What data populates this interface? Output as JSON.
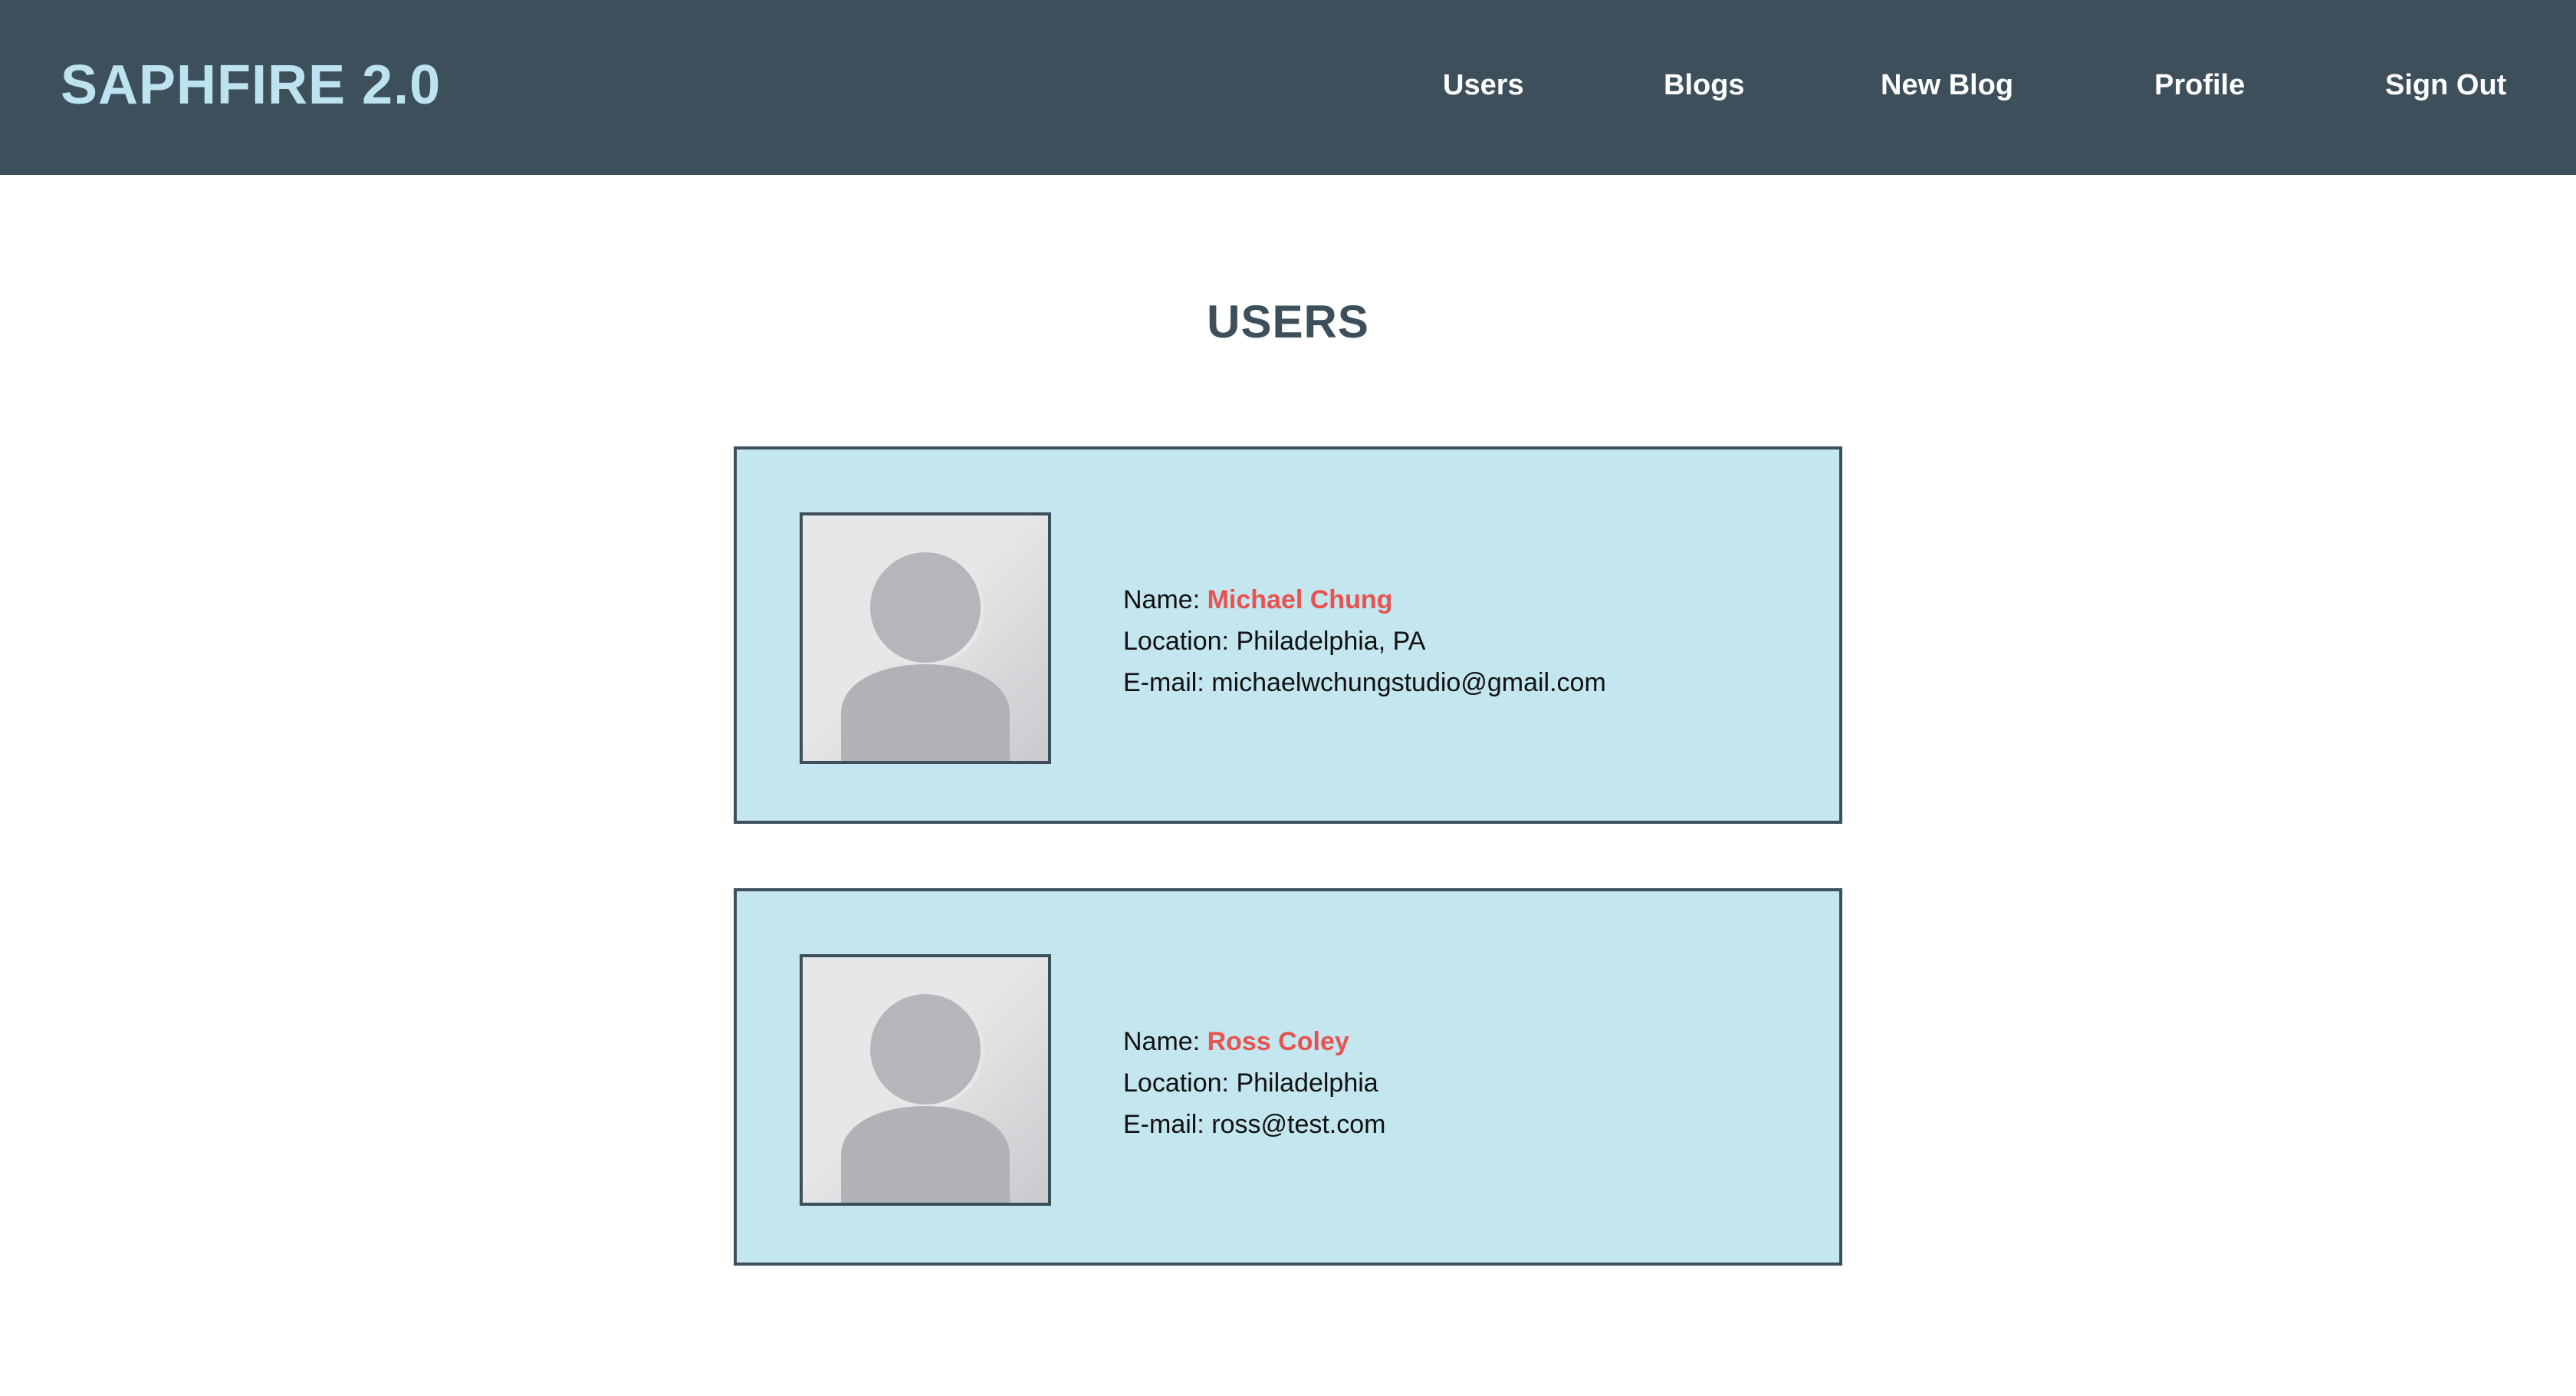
{
  "header": {
    "brand": "SAPHFIRE 2.0",
    "nav": [
      {
        "label": "Users"
      },
      {
        "label": "Blogs"
      },
      {
        "label": "New Blog"
      },
      {
        "label": "Profile"
      },
      {
        "label": "Sign Out"
      }
    ]
  },
  "main": {
    "title": "USERS",
    "users": [
      {
        "name_label": "Name:",
        "name": "Michael Chung",
        "location_label": "Location:",
        "location": "Philadelphia, PA",
        "email_label": "E-mail:",
        "email": "michaelwchungstudio@gmail.com"
      },
      {
        "name_label": "Name:",
        "name": "Ross Coley",
        "location_label": "Location:",
        "location": "Philadelphia",
        "email_label": "E-mail:",
        "email": "ross@test.com"
      }
    ]
  },
  "colors": {
    "navbar_bg": "#3d4f5b",
    "brand": "#bde3f0",
    "card_bg": "#c3e6ef",
    "name_accent": "#e8524f",
    "title": "#3d4f5b"
  },
  "icons": {
    "avatar_placeholder": "default-user-icon"
  }
}
